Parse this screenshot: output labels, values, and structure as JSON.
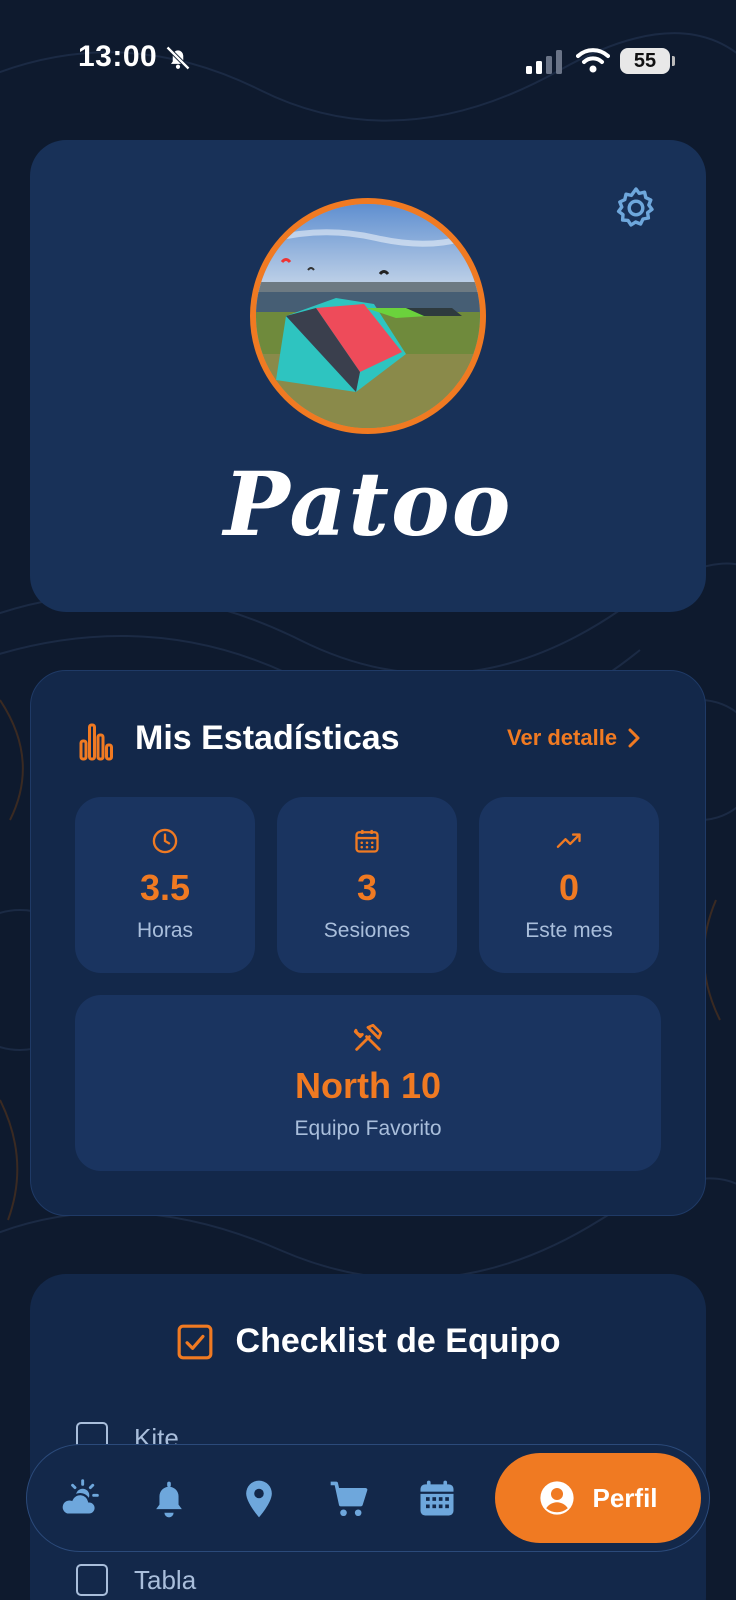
{
  "status_bar": {
    "time": "13:00",
    "battery": "55"
  },
  "profile": {
    "username": "Patoo"
  },
  "stats": {
    "title": "Mis Estadísticas",
    "detail_link": "Ver detalle",
    "tiles": [
      {
        "icon": "clock-icon",
        "value": "3.5",
        "label": "Horas"
      },
      {
        "icon": "calendar-icon",
        "value": "3",
        "label": "Sesiones"
      },
      {
        "icon": "trending-up-icon",
        "value": "0",
        "label": "Este mes"
      }
    ],
    "favorite": {
      "icon": "tools-icon",
      "value": "North 10",
      "label": "Equipo Favorito"
    }
  },
  "checklist": {
    "title": "Checklist de Equipo",
    "items": [
      {
        "label": "Kite",
        "checked": false
      },
      {
        "label": "Tabla",
        "checked": false
      }
    ]
  },
  "nav": {
    "items": [
      "weather-icon",
      "bell-icon",
      "location-icon",
      "cart-icon",
      "calendar-icon"
    ],
    "active_label": "Perfil"
  },
  "colors": {
    "accent": "#f07a22",
    "card": "#183158",
    "background": "#0e1a2e",
    "muted_text": "#a9bedb"
  }
}
